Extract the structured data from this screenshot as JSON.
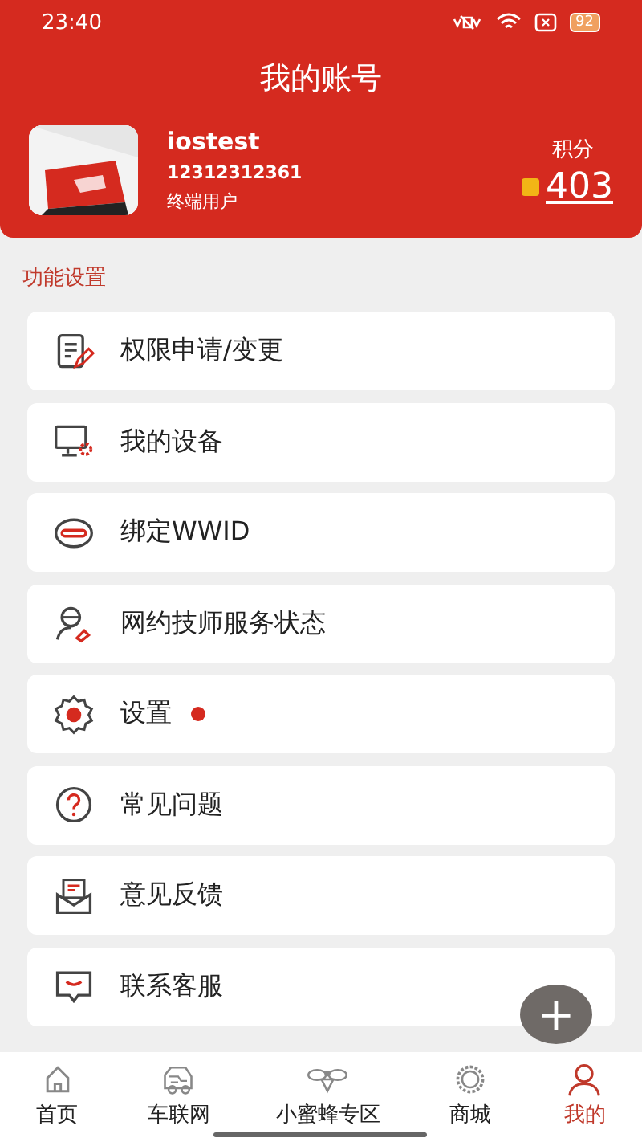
{
  "status_bar": {
    "time": "23:40",
    "battery": "92"
  },
  "header": {
    "title": "我的账号",
    "username": "iostest",
    "phone": "12312312361",
    "role": "终端用户",
    "points_label": "积分",
    "points": "403"
  },
  "section_title": "功能设置",
  "menu": [
    {
      "kind": "apply",
      "label": "权限申请/变更",
      "badge": false
    },
    {
      "kind": "device",
      "label": "我的设备",
      "badge": false
    },
    {
      "kind": "link",
      "label": "绑定WWID",
      "badge": false
    },
    {
      "kind": "technician",
      "label": "网约技师服务状态",
      "badge": false
    },
    {
      "kind": "settings",
      "label": "设置",
      "badge": true
    },
    {
      "kind": "faq",
      "label": "常见问题",
      "badge": false
    },
    {
      "kind": "feedback",
      "label": "意见反馈",
      "badge": false
    },
    {
      "kind": "service",
      "label": "联系客服",
      "badge": false
    }
  ],
  "fab": "+",
  "tabs": [
    {
      "kind": "home",
      "label": "首页",
      "selected": false
    },
    {
      "kind": "car",
      "label": "车联网",
      "selected": false
    },
    {
      "kind": "bee",
      "label": "小蜜蜂专区",
      "selected": false
    },
    {
      "kind": "shop",
      "label": "商城",
      "selected": false
    },
    {
      "kind": "me",
      "label": "我的",
      "selected": true
    }
  ]
}
